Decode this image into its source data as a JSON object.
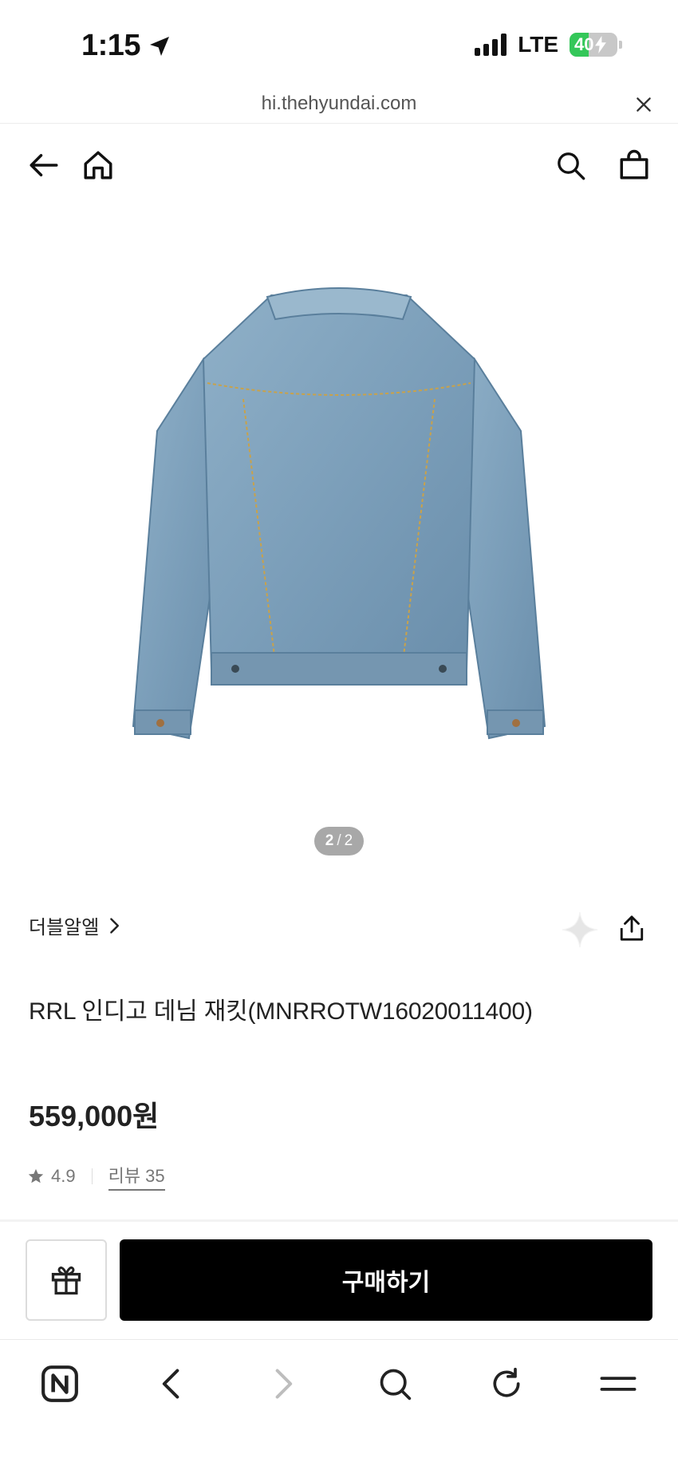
{
  "status_bar": {
    "time": "1:15",
    "network": "LTE",
    "battery_percent": "40",
    "battery_level": 0.4,
    "battery_color": "#34c759"
  },
  "browser": {
    "url": "hi.thehyundai.com"
  },
  "header": {
    "icons": [
      "back-arrow-icon",
      "home-icon",
      "search-icon",
      "shopping-bag-icon"
    ]
  },
  "gallery": {
    "current": "2",
    "separator": "/",
    "total": "2",
    "image_subject": "denim-jacket-back-view"
  },
  "product": {
    "brand": "더블알엘",
    "title": "RRL 인디고 데님 재킷(MNRROTW16020011400)",
    "price": "559,000원",
    "rating": "4.9",
    "review_label": "리뷰 35"
  },
  "actions": {
    "buy_label": "구매하기",
    "buy_color": "#000000"
  },
  "toolbar": {
    "icons": [
      "naver-n-icon",
      "back-chevron-icon",
      "forward-chevron-icon",
      "search-icon",
      "reload-icon",
      "menu-icon"
    ]
  }
}
